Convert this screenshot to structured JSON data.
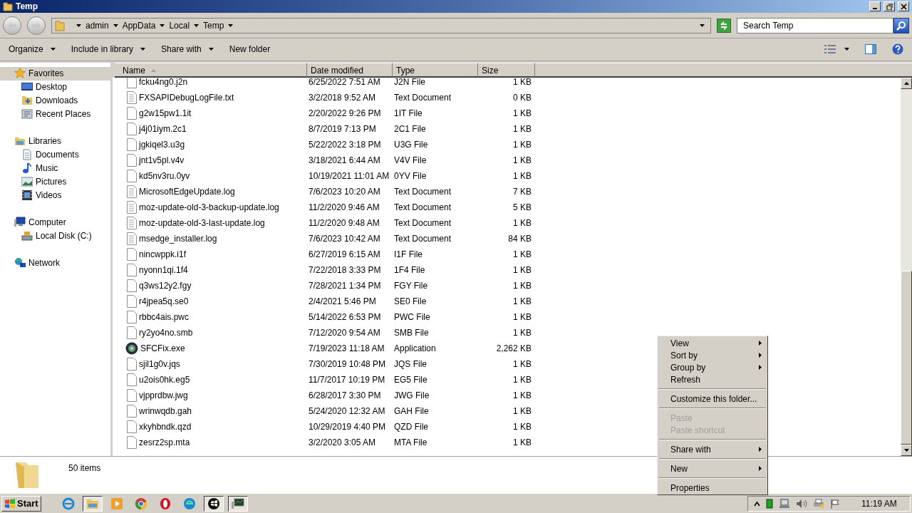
{
  "window": {
    "title": "Temp"
  },
  "address": {
    "crumbs": [
      "admin",
      "AppData",
      "Local",
      "Temp"
    ]
  },
  "search": {
    "placeholder": "Search Temp"
  },
  "toolbar": [
    {
      "label": "Organize",
      "dropdown": true
    },
    {
      "label": "Include in library",
      "dropdown": true
    },
    {
      "label": "Share with",
      "dropdown": true
    },
    {
      "label": "New folder",
      "dropdown": false
    }
  ],
  "sidebar": [
    {
      "label": "Favorites",
      "selected": true,
      "children": [
        {
          "label": "Desktop",
          "selected": false
        },
        {
          "label": "Downloads",
          "selected": false
        },
        {
          "label": "Recent Places",
          "selected": false
        }
      ]
    },
    {
      "label": "Libraries",
      "selected": false,
      "children": [
        {
          "label": "Documents",
          "selected": false
        },
        {
          "label": "Music",
          "selected": false
        },
        {
          "label": "Pictures",
          "selected": false
        },
        {
          "label": "Videos",
          "selected": false
        }
      ]
    },
    {
      "label": "Computer",
      "selected": false,
      "children": [
        {
          "label": "Local Disk (C:)",
          "selected": false
        }
      ]
    },
    {
      "label": "Network",
      "selected": false
    }
  ],
  "table": {
    "columns": [
      {
        "label": "Name",
        "sorted": true
      },
      {
        "label": "Date modified",
        "sorted": false
      },
      {
        "label": "Type",
        "sorted": false
      },
      {
        "label": "Size",
        "sorted": false
      }
    ],
    "rows": [
      {
        "name": "fcku4ng0.j2n",
        "date": "6/25/2022 7:51 AM",
        "type": "J2N File",
        "size": "1 KB",
        "kind": "file"
      },
      {
        "name": "FXSAPIDebugLogFile.txt",
        "date": "3/2/2018 9:52 AM",
        "type": "Text Document",
        "size": "0 KB",
        "kind": "text"
      },
      {
        "name": "g2w15pw1.1it",
        "date": "2/20/2022 9:26 PM",
        "type": "1IT File",
        "size": "1 KB",
        "kind": "file"
      },
      {
        "name": "j4j01iym.2c1",
        "date": "8/7/2019 7:13 PM",
        "type": "2C1 File",
        "size": "1 KB",
        "kind": "file"
      },
      {
        "name": "jgkiqel3.u3g",
        "date": "5/22/2022 3:18 PM",
        "type": "U3G File",
        "size": "1 KB",
        "kind": "file"
      },
      {
        "name": "jnt1v5pl.v4v",
        "date": "3/18/2021 6:44 AM",
        "type": "V4V File",
        "size": "1 KB",
        "kind": "file"
      },
      {
        "name": "kd5nv3ru.0yv",
        "date": "10/19/2021 11:01 AM",
        "type": "0YV File",
        "size": "1 KB",
        "kind": "file"
      },
      {
        "name": "MicrosoftEdgeUpdate.log",
        "date": "7/6/2023 10:20 AM",
        "type": "Text Document",
        "size": "7 KB",
        "kind": "text"
      },
      {
        "name": "moz-update-old-3-backup-update.log",
        "date": "11/2/2020 9:46 AM",
        "type": "Text Document",
        "size": "5 KB",
        "kind": "text"
      },
      {
        "name": "moz-update-old-3-last-update.log",
        "date": "11/2/2020 9:48 AM",
        "type": "Text Document",
        "size": "1 KB",
        "kind": "text"
      },
      {
        "name": "msedge_installer.log",
        "date": "7/6/2023 10:42 AM",
        "type": "Text Document",
        "size": "84 KB",
        "kind": "text"
      },
      {
        "name": "nincwppk.i1f",
        "date": "6/27/2019 6:15 AM",
        "type": "I1F File",
        "size": "1 KB",
        "kind": "file"
      },
      {
        "name": "nyonn1qi.1f4",
        "date": "7/22/2018 3:33 PM",
        "type": "1F4 File",
        "size": "1 KB",
        "kind": "file"
      },
      {
        "name": "q3ws12y2.fgy",
        "date": "7/28/2021 1:34 PM",
        "type": "FGY File",
        "size": "1 KB",
        "kind": "file"
      },
      {
        "name": "r4jpea5q.se0",
        "date": "2/4/2021 5:46 PM",
        "type": "SE0 File",
        "size": "1 KB",
        "kind": "file"
      },
      {
        "name": "rbbc4ais.pwc",
        "date": "5/14/2022 6:53 PM",
        "type": "PWC File",
        "size": "1 KB",
        "kind": "file"
      },
      {
        "name": "ry2yo4no.smb",
        "date": "7/12/2020 9:54 AM",
        "type": "SMB File",
        "size": "1 KB",
        "kind": "file"
      },
      {
        "name": "SFCFix.exe",
        "date": "7/19/2023 11:18 AM",
        "type": "Application",
        "size": "2,262 KB",
        "kind": "app"
      },
      {
        "name": "sjil1g0v.jqs",
        "date": "7/30/2019 10:48 PM",
        "type": "JQS File",
        "size": "1 KB",
        "kind": "file"
      },
      {
        "name": "u2ois0hk.eg5",
        "date": "11/7/2017 10:19 PM",
        "type": "EG5 File",
        "size": "1 KB",
        "kind": "file"
      },
      {
        "name": "vjpprdbw.jwg",
        "date": "6/28/2017 3:30 PM",
        "type": "JWG File",
        "size": "1 KB",
        "kind": "file"
      },
      {
        "name": "wrinwqdb.gah",
        "date": "5/24/2020 12:32 AM",
        "type": "GAH File",
        "size": "1 KB",
        "kind": "file"
      },
      {
        "name": "xkyhbndk.qzd",
        "date": "10/29/2019 4:40 PM",
        "type": "QZD File",
        "size": "1 KB",
        "kind": "file"
      },
      {
        "name": "zesrz2sp.mta",
        "date": "3/2/2020 3:05 AM",
        "type": "MTA File",
        "size": "1 KB",
        "kind": "file"
      }
    ]
  },
  "details": {
    "count": "50 items"
  },
  "context_menu": [
    {
      "label": "View",
      "submenu": true,
      "disabled": false,
      "separator_after": false
    },
    {
      "label": "Sort by",
      "submenu": true,
      "disabled": false,
      "separator_after": false
    },
    {
      "label": "Group by",
      "submenu": true,
      "disabled": false,
      "separator_after": false
    },
    {
      "label": "Refresh",
      "submenu": false,
      "disabled": false,
      "separator_after": true
    },
    {
      "label": "Customize this folder...",
      "submenu": false,
      "disabled": false,
      "separator_after": true
    },
    {
      "label": "Paste",
      "submenu": false,
      "disabled": true,
      "separator_after": false
    },
    {
      "label": "Paste shortcut",
      "submenu": false,
      "disabled": true,
      "separator_after": true
    },
    {
      "label": "Share with",
      "submenu": true,
      "disabled": false,
      "separator_after": true
    },
    {
      "label": "New",
      "submenu": true,
      "disabled": false,
      "separator_after": true
    },
    {
      "label": "Properties",
      "submenu": false,
      "disabled": false,
      "separator_after": false
    }
  ],
  "taskbar": {
    "start": "Start",
    "buttons": [
      {
        "kind": "ie",
        "active": false
      },
      {
        "kind": "explorer",
        "active": true
      },
      {
        "kind": "media",
        "active": false
      },
      {
        "kind": "chrome",
        "active": false
      },
      {
        "kind": "opera",
        "active": false
      },
      {
        "kind": "edge",
        "active": false
      },
      {
        "kind": "app",
        "active": true
      },
      {
        "kind": "monitor",
        "active": true
      }
    ],
    "clock": "11:19 AM"
  }
}
